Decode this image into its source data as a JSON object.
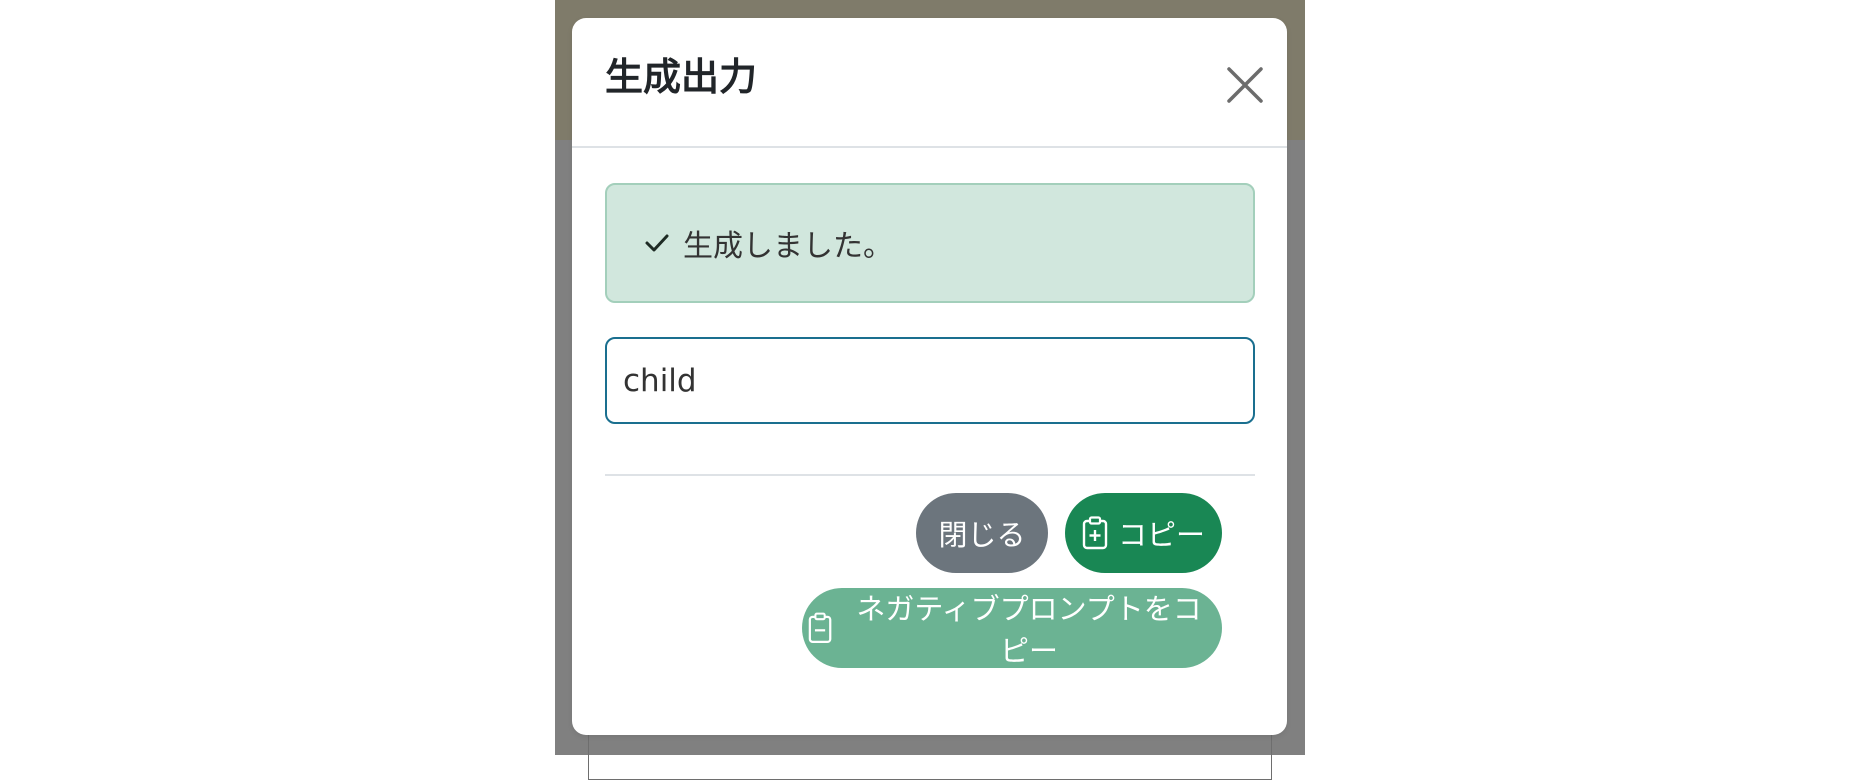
{
  "modal": {
    "title": "生成出力",
    "alert_message": "生成しました。",
    "output_value": "child",
    "buttons": {
      "close_label": "閉じる",
      "copy_label": "コピー",
      "copy_negative_label": "ネガティブプロンプトをコピー"
    }
  },
  "icons": {
    "close": "x-icon",
    "check": "check-icon",
    "copy": "clipboard-plus-icon",
    "copy_negative": "clipboard-minus-icon"
  },
  "colors": {
    "success_alert_bg": "#d1e7dd",
    "input_border": "#1a6f8f",
    "secondary_button": "#6c757d",
    "success_button": "#198754",
    "success_button_light": "#6bb393",
    "backdrop": "#808080"
  }
}
